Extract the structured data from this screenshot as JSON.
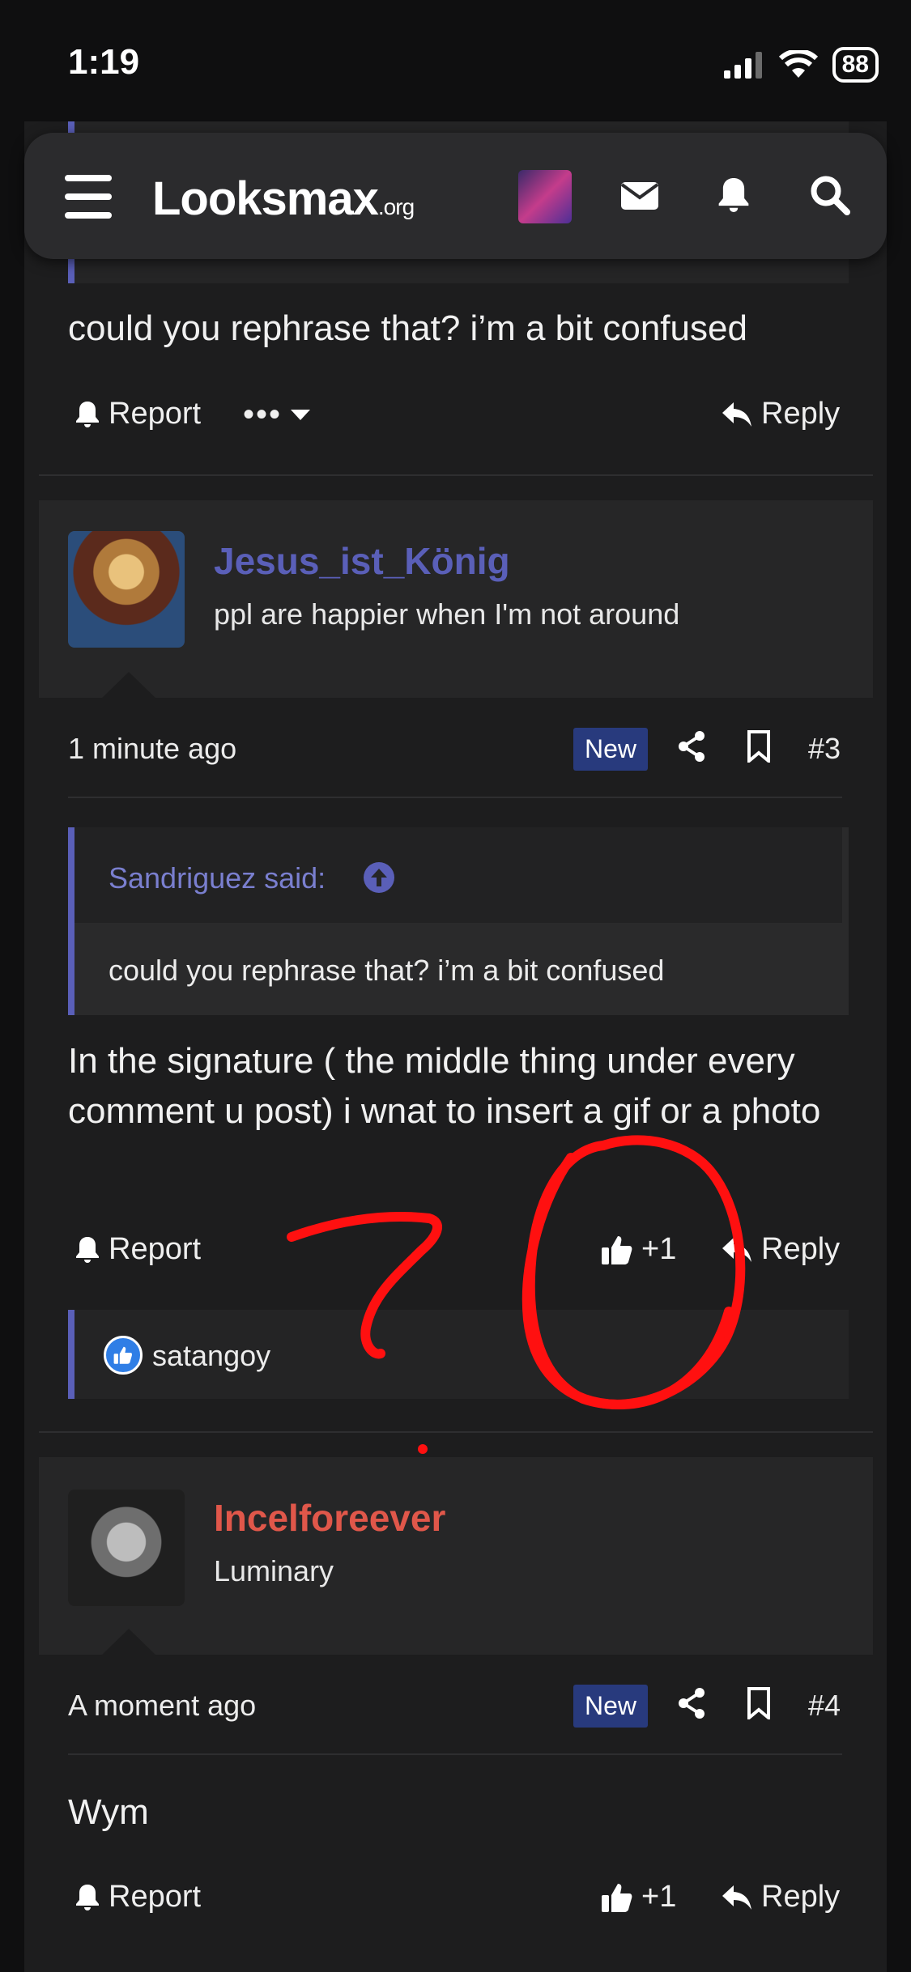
{
  "status": {
    "time": "1:19",
    "battery": "88"
  },
  "nav": {
    "logo_main": "Looksmax",
    "logo_suffix": ".org"
  },
  "post_prev": {
    "body": "could you rephrase that? i’m a bit confused",
    "report": "Report",
    "reply": "Reply"
  },
  "post3": {
    "author": "Jesus_ist_König",
    "author_color": "#5a5fb8",
    "user_title": "ppl are happier when I'm not around",
    "time": "1 minute ago",
    "badge": "New",
    "number": "#3",
    "quote_attrib": "Sandriguez said:",
    "quote_text": "could you rephrase that? i’m a bit confused",
    "body": "In the signature ( the middle thing under every comment u post) i wnat to insert a gif or a photo",
    "report": "Report",
    "likes": "+1",
    "reply": "Reply",
    "reaction_user": "satangoy"
  },
  "post4": {
    "author": "Incelforeever",
    "author_color": "#e0574a",
    "user_title": "Luminary",
    "time": "A moment ago",
    "badge": "New",
    "number": "#4",
    "body": "Wym",
    "report": "Report",
    "likes": "+1",
    "reply": "Reply"
  },
  "annotation_color": "#ff1010"
}
